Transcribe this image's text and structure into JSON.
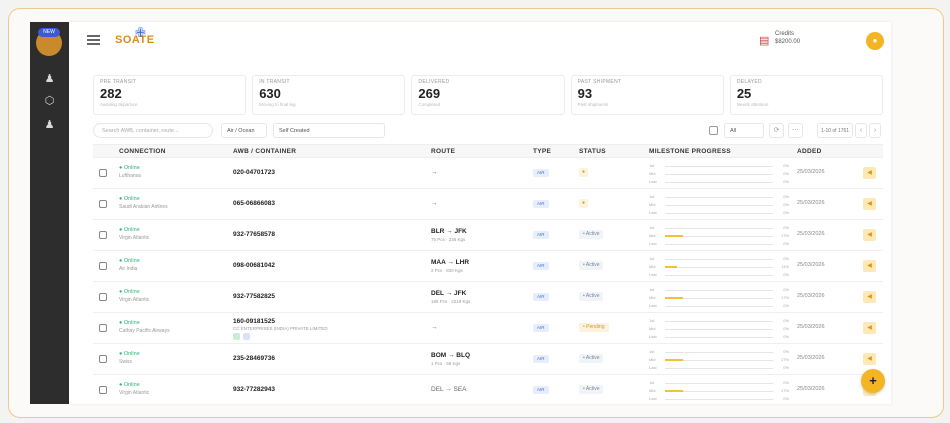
{
  "header": {
    "brand": "SOATE",
    "credit_label": "Credits",
    "credit_value": "$8200.00"
  },
  "sidebar": {
    "badge": "NEW"
  },
  "stats": [
    {
      "label": "PRE TRANSIT",
      "value": "282",
      "sub": "Awaiting departure"
    },
    {
      "label": "IN TRANSIT",
      "value": "630",
      "sub": "Moving to final leg"
    },
    {
      "label": "DELIVERED",
      "value": "269",
      "sub": "Completed"
    },
    {
      "label": "PAST SHIPMENT",
      "value": "93",
      "sub": "Past shipments"
    },
    {
      "label": "DELAYED",
      "value": "25",
      "sub": "Needs attention"
    }
  ],
  "filters": {
    "search_placeholder": "Search AWB, container, route...",
    "mode": "Air / Ocean",
    "source": "Self Created",
    "all": "All",
    "page_info": "1-10 of 1761"
  },
  "table": {
    "columns": [
      "CONNECTION",
      "AWB / CONTAINER",
      "ROUTE",
      "TYPE",
      "STATUS",
      "MILESTONE PROGRESS",
      "ADDED"
    ],
    "rows": [
      {
        "status": "● Online",
        "carrier": "Lufthansa",
        "awb": "020-04701723",
        "route": "→",
        "type": "AIR",
        "state": "●",
        "pct": 0,
        "added": "25/03/2026"
      },
      {
        "status": "● Online",
        "carrier": "Saudi Arabian Airlines",
        "awb": "065-06866083",
        "route": "→",
        "type": "AIR",
        "state": "●",
        "pct": 0,
        "added": "25/03/2026"
      },
      {
        "status": "● Online",
        "carrier": "Virgin Atlantic",
        "awb": "932-77658578",
        "route": "BLR → JFK",
        "route_sub": "75 Pcs · 236 Kgs",
        "type": "AIR",
        "state": "• Active",
        "pct": 17,
        "added": "25/03/2026"
      },
      {
        "status": "● Online",
        "carrier": "Air India",
        "awb": "098-00681042",
        "route": "MAA → LHR",
        "route_sub": "2 Pcs · 830 Kgs",
        "type": "AIR",
        "state": "• Active",
        "pct": 11,
        "added": "25/03/2026"
      },
      {
        "status": "● Online",
        "carrier": "Virgin Atlantic",
        "awb": "932-77582825",
        "route": "DEL → JFK",
        "route_sub": "185 Pcs · 2219 Kgs",
        "type": "AIR",
        "state": "• Active",
        "pct": 17,
        "added": "25/03/2026"
      },
      {
        "status": "● Online",
        "carrier": "Cathay Pacific Airways",
        "awb": "160-09181525",
        "awb_sub": "CC ENTERPRISES (INDIA) PRIVATE LIMITED",
        "route": "→",
        "type": "AIR",
        "state": "• Pending",
        "pct": 0,
        "added": "25/03/2026"
      },
      {
        "status": "● Online",
        "carrier": "Swiss",
        "awb": "235-28469736",
        "route": "BOM → BLQ",
        "route_sub": "1 Pcs · 58 Kgs",
        "type": "AIR",
        "state": "• Active",
        "pct": 17,
        "added": "25/03/2026"
      },
      {
        "status": "● Online",
        "carrier": "Virgin Atlantic",
        "awb": "932-77282943",
        "route": "DEL → SEA",
        "route_sub": "",
        "type": "AIR",
        "state": "• Active",
        "pct": 17,
        "added": "25/03/2026"
      }
    ],
    "milestones": [
      "1st",
      "Mid",
      "Last"
    ]
  },
  "fab": "+"
}
